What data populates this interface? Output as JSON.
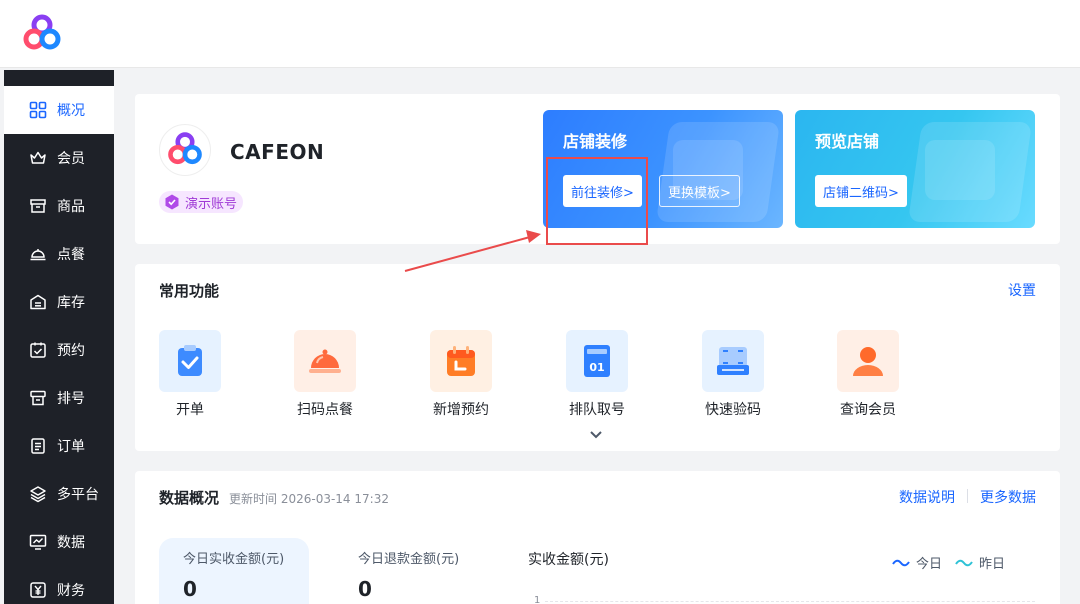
{
  "sidebar": {
    "items": [
      {
        "label": "概况",
        "icon": "grid-icon"
      },
      {
        "label": "会员",
        "icon": "crown-icon"
      },
      {
        "label": "商品",
        "icon": "box-icon"
      },
      {
        "label": "点餐",
        "icon": "dish-icon"
      },
      {
        "label": "库存",
        "icon": "inventory-icon"
      },
      {
        "label": "预约",
        "icon": "calendar-check-icon"
      },
      {
        "label": "排号",
        "icon": "queue-icon"
      },
      {
        "label": "订单",
        "icon": "order-icon"
      },
      {
        "label": "多平台",
        "icon": "layers-icon"
      },
      {
        "label": "数据",
        "icon": "monitor-chart-icon"
      },
      {
        "label": "财务",
        "icon": "yen-icon"
      }
    ]
  },
  "store": {
    "name": "CAFEON",
    "badge": "演示账号"
  },
  "promos": {
    "decorate": {
      "title": "店铺装修",
      "primary": "前往装修>",
      "secondary": "更换模板>"
    },
    "preview": {
      "title": "预览店铺",
      "primary": "店铺二维码>"
    }
  },
  "functions": {
    "title": "常用功能",
    "settings": "设置",
    "items": [
      {
        "label": "开单",
        "icon": "clipboard-check-icon"
      },
      {
        "label": "扫码点餐",
        "icon": "dish-cloche-icon"
      },
      {
        "label": "新增预约",
        "icon": "calendar-icon"
      },
      {
        "label": "排队取号",
        "icon": "ticket-number-icon"
      },
      {
        "label": "快速验码",
        "icon": "scanner-icon"
      },
      {
        "label": "查询会员",
        "icon": "member-icon"
      }
    ],
    "icon_number": "01"
  },
  "data": {
    "title": "数据概况",
    "update_time": "更新时间 2026-03-14 17:32",
    "explain_link": "数据说明",
    "more_link": "更多数据",
    "stats": [
      {
        "label": "今日实收金额(元)",
        "value": "0"
      },
      {
        "label": "今日退款金额(元)",
        "value": "0"
      }
    ],
    "chart": {
      "title": "实收金额(元)",
      "legend": [
        "今日",
        "昨日"
      ],
      "y_tick": "1"
    }
  },
  "colors": {
    "primary": "#1a66ff",
    "sidebar_bg": "#1e2128",
    "annotation": "#ea4b4b"
  }
}
